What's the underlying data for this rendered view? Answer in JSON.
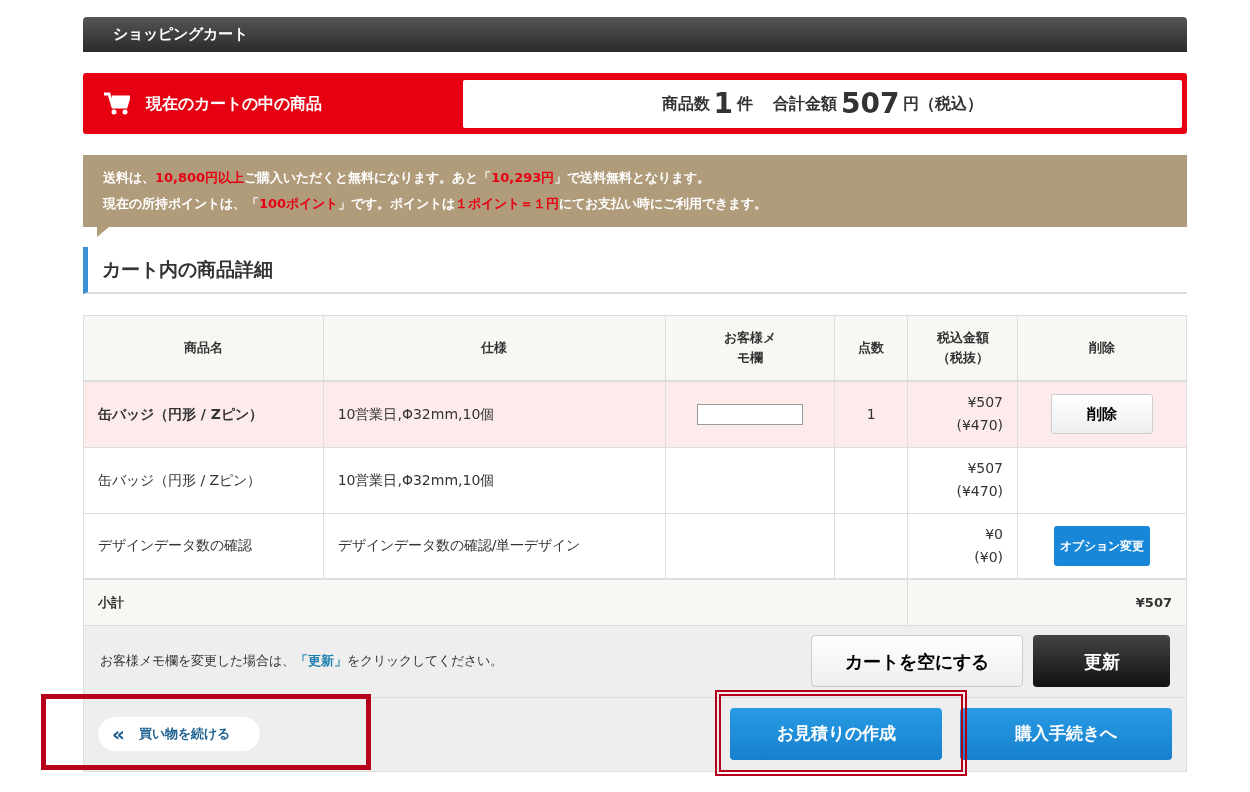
{
  "header": {
    "title": "ショッピングカート"
  },
  "summary": {
    "label": "現在のカートの中の商品",
    "count_label": "商品数",
    "count": "1",
    "count_unit": "件",
    "total_label": "合計金額",
    "total": "507",
    "total_unit": "円（税込）"
  },
  "notice": {
    "lines": [
      [
        {
          "kind": "plain",
          "text": "送料は、"
        },
        {
          "kind": "emph",
          "text": "10,800円以上"
        },
        {
          "kind": "plain",
          "text": "ご購入いただくと無料になります。あと「"
        },
        {
          "kind": "emph",
          "text": "10,293円"
        },
        {
          "kind": "plain",
          "text": "」で送料無料となります。"
        }
      ],
      [
        {
          "kind": "plain",
          "text": "現在の所持ポイントは、「"
        },
        {
          "kind": "emph",
          "text": "100ポイント"
        },
        {
          "kind": "plain",
          "text": "」です。ポイントは"
        },
        {
          "kind": "emph",
          "text": "１ポイント＝１円"
        },
        {
          "kind": "plain",
          "text": "にてお支払い時にご利用できます。"
        }
      ]
    ]
  },
  "section": {
    "title": "カート内の商品詳細"
  },
  "table": {
    "columns": [
      "商品名",
      "仕様",
      "お客様メモ欄",
      "点数",
      "税込金額（税抜）",
      "削除"
    ],
    "rows": [
      {
        "highlighted": true,
        "name": "缶バッジ（円形 / Zピン）",
        "spec": "10営業日,Φ32mm,10個",
        "memo": {
          "kind": "input"
        },
        "qty": "1",
        "price": "¥507",
        "price_ex": "(¥470)",
        "action": {
          "kind": "delete",
          "label": "削除"
        }
      },
      {
        "highlighted": false,
        "name": "缶バッジ（円形 / Zピン）",
        "spec": "10営業日,Φ32mm,10個",
        "memo": {
          "kind": "none"
        },
        "qty": "",
        "price": "¥507",
        "price_ex": "(¥470)",
        "action": {
          "kind": "none"
        }
      },
      {
        "highlighted": false,
        "name": "デザインデータ数の確認",
        "spec": "デザインデータ数の確認/単一デザイン",
        "memo": {
          "kind": "none"
        },
        "qty": "",
        "price": "¥0",
        "price_ex": "(¥0)",
        "action": {
          "kind": "option",
          "label": "オプション変更"
        }
      }
    ],
    "subtotal_label": "小計",
    "subtotal": "¥507"
  },
  "memo_note": {
    "before": "お客様メモ欄を変更した場合は、",
    "link": "「更新」",
    "after": "をクリックしてください。"
  },
  "buttons": {
    "empty": "カートを空にする",
    "update": "更新"
  },
  "actions": {
    "continue": {
      "label": "買い物を続ける",
      "icon": "«",
      "highlighted": true
    },
    "estimate": {
      "label": "お見積りの作成",
      "highlighted": true
    },
    "checkout": {
      "label": "購入手続きへ"
    }
  }
}
